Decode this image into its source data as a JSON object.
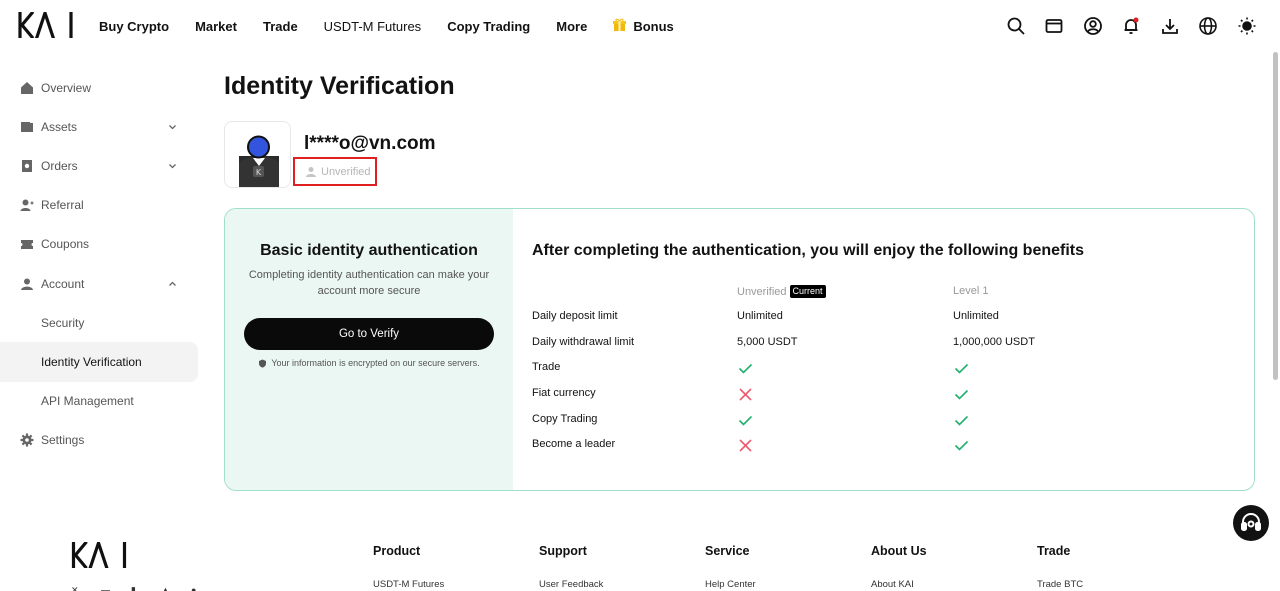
{
  "header": {
    "logo_text": "KAI",
    "nav": [
      "Buy Crypto",
      "Market",
      "Trade",
      "USDT-M Futures",
      "Copy Trading",
      "More",
      "Bonus"
    ],
    "icons": [
      "search-icon",
      "wallet-icon",
      "user-circle-icon",
      "bell-icon",
      "download-icon",
      "globe-icon",
      "theme-sun-icon"
    ]
  },
  "sidebar": {
    "items": [
      {
        "label": "Overview",
        "icon": "home-icon"
      },
      {
        "label": "Assets",
        "icon": "wallet-icon"
      },
      {
        "label": "Orders",
        "icon": "orders-icon"
      },
      {
        "label": "Referral",
        "icon": "referral-icon"
      },
      {
        "label": "Coupons",
        "icon": "coupon-icon"
      },
      {
        "label": "Account",
        "icon": "user-icon"
      },
      {
        "label": "Security"
      },
      {
        "label": "Identity Verification"
      },
      {
        "label": "API Management"
      },
      {
        "label": "Settings",
        "icon": "gear-icon"
      }
    ]
  },
  "main": {
    "title": "Identity Verification",
    "email": "l****o@vn.com",
    "status": "Unverified"
  },
  "card": {
    "left_title": "Basic identity authentication",
    "left_desc": "Completing identity authentication can make your account more secure",
    "verify_button": "Go to Verify",
    "secure_note": "Your information is encrypted on our secure servers.",
    "right_title": "After completing the authentication, you will enjoy the following benefits",
    "col_unverified": "Unverified",
    "col_current_badge": "Current",
    "col_level1": "Level 1",
    "rows": [
      {
        "label": "Daily deposit limit",
        "unverified": "Unlimited",
        "level1": "Unlimited"
      },
      {
        "label": "Daily withdrawal limit",
        "unverified": "5,000 USDT",
        "level1": "1,000,000 USDT"
      },
      {
        "label": "Trade",
        "unverified": "check",
        "level1": "check"
      },
      {
        "label": "Fiat currency",
        "unverified": "cross",
        "level1": "check"
      },
      {
        "label": "Copy Trading",
        "unverified": "check",
        "level1": "check"
      },
      {
        "label": "Become a leader",
        "unverified": "cross",
        "level1": "check"
      }
    ],
    "check_color": "#20b26c",
    "cross_color": "#ef5a6f"
  },
  "footer": {
    "logo_text": "KAI",
    "columns": [
      {
        "heading": "Product",
        "first_link": "USDT-M Futures"
      },
      {
        "heading": "Support",
        "first_link": "User Feedback"
      },
      {
        "heading": "Service",
        "first_link": "Help Center"
      },
      {
        "heading": "About Us",
        "first_link": "About KAI"
      },
      {
        "heading": "Trade",
        "first_link": "Trade BTC"
      }
    ]
  }
}
